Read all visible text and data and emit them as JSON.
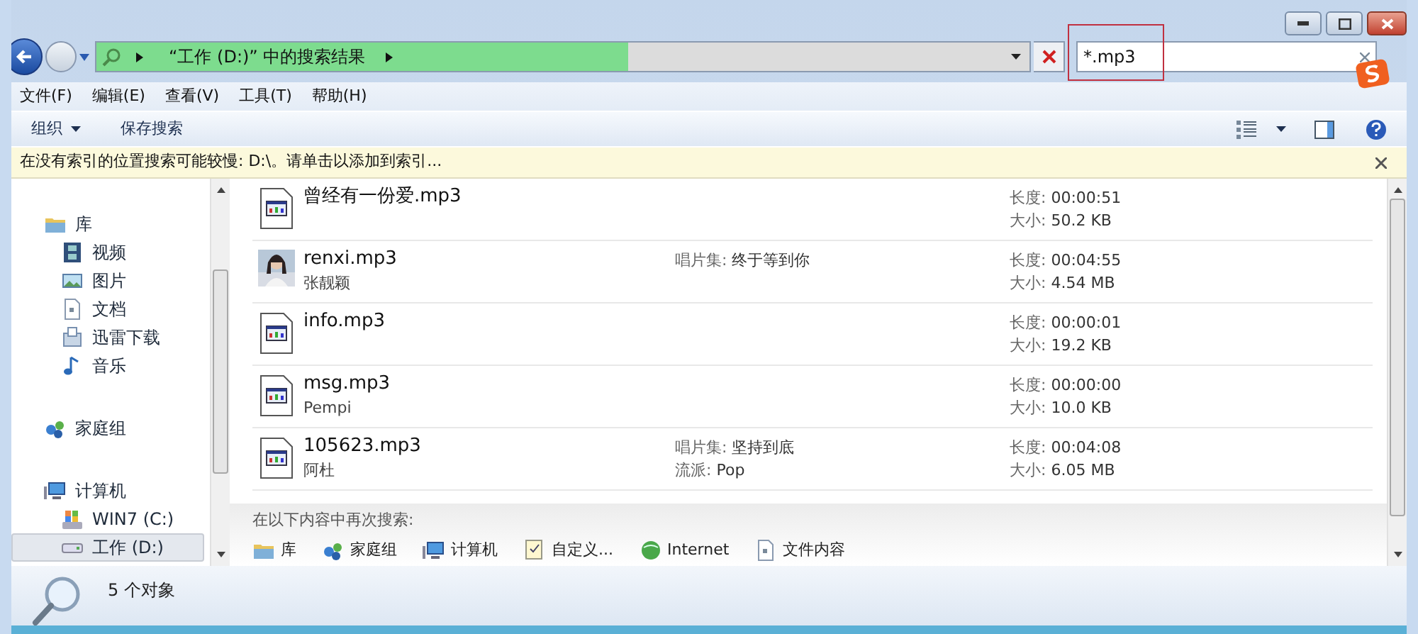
{
  "address_bar": {
    "path": "“工作 (D:)” 中的搜索结果",
    "level": 0.57
  },
  "search": {
    "value": "*.mp3"
  },
  "menu": [
    "文件(F)",
    "编辑(E)",
    "查看(V)",
    "工具(T)",
    "帮助(H)"
  ],
  "toolbar": [
    {
      "label": "组织",
      "dropdown": true
    },
    {
      "label": "保存搜索",
      "dropdown": false
    }
  ],
  "info_bar": {
    "text": "在没有索引的位置搜索可能较慢: D:\\。请单击以添加到索引..."
  },
  "sidebar": [
    {
      "label": "库",
      "kind": "library",
      "selected": false,
      "children": [
        {
          "label": "视频",
          "kind": "video",
          "selected": false
        },
        {
          "label": "图片",
          "selected": false
        },
        {
          "label": "文档",
          "kind": "document",
          "selected": false
        },
        {
          "label": "迅雷下载",
          "kind": "download",
          "selected": false
        },
        {
          "label": "音乐",
          "kind": "music",
          "selected": false
        }
      ]
    },
    {
      "label": "家庭组",
      "kind": "homegroup",
      "selected": false
    },
    {
      "label": "计算机",
      "kind": "computer",
      "selected": false,
      "children": [
        {
          "label": "WIN7 (C:)",
          "kind": "system-drive",
          "selected": false
        },
        {
          "label": "工作 (D:)",
          "kind": "drive",
          "selected": true
        }
      ]
    }
  ],
  "results": [
    {
      "name": "曾经有一份爱.mp3",
      "kind": "file",
      "length_label": "长度:",
      "length": "00:00:51",
      "size_label": "大小:",
      "size": "50.2 KB"
    },
    {
      "name": "renxi.mp3",
      "kind": "picture",
      "subtitle": "张靓颖",
      "details": [
        {
          "label": "唱片集:",
          "value": "终于等到你"
        }
      ],
      "length_label": "长度:",
      "length": "00:04:55",
      "size_label": "大小:",
      "size": "4.54 MB"
    },
    {
      "name": "info.mp3",
      "kind": "file",
      "length_label": "长度:",
      "length": "00:00:01",
      "size_label": "大小:",
      "size": "19.2 KB"
    },
    {
      "name": "msg.mp3",
      "kind": "file",
      "subtitle": "Pempi",
      "length_label": "长度:",
      "length": "00:00:00",
      "size_label": "大小:",
      "size": "10.0 KB"
    },
    {
      "name": "105623.mp3",
      "kind": "file",
      "subtitle": "阿杜",
      "details": [
        {
          "label": "唱片集:",
          "value": "坚持到底"
        },
        {
          "label": "流派:",
          "value": "Pop"
        }
      ],
      "length_label": "长度:",
      "length": "00:04:08",
      "size_label": "大小:",
      "size": "6.05 MB"
    }
  ],
  "search_again": {
    "title": "在以下内容中再次搜索:",
    "items": [
      {
        "label": "库",
        "kind": "library"
      },
      {
        "label": "家庭组",
        "kind": "homegroup"
      },
      {
        "label": "计算机",
        "kind": "computer"
      },
      {
        "label": "自定义...",
        "kind": "custom"
      },
      {
        "label": "Internet",
        "kind": "internet"
      },
      {
        "label": "文件内容",
        "kind": "document"
      }
    ]
  },
  "status_bar": {
    "text": "5 个对象"
  }
}
